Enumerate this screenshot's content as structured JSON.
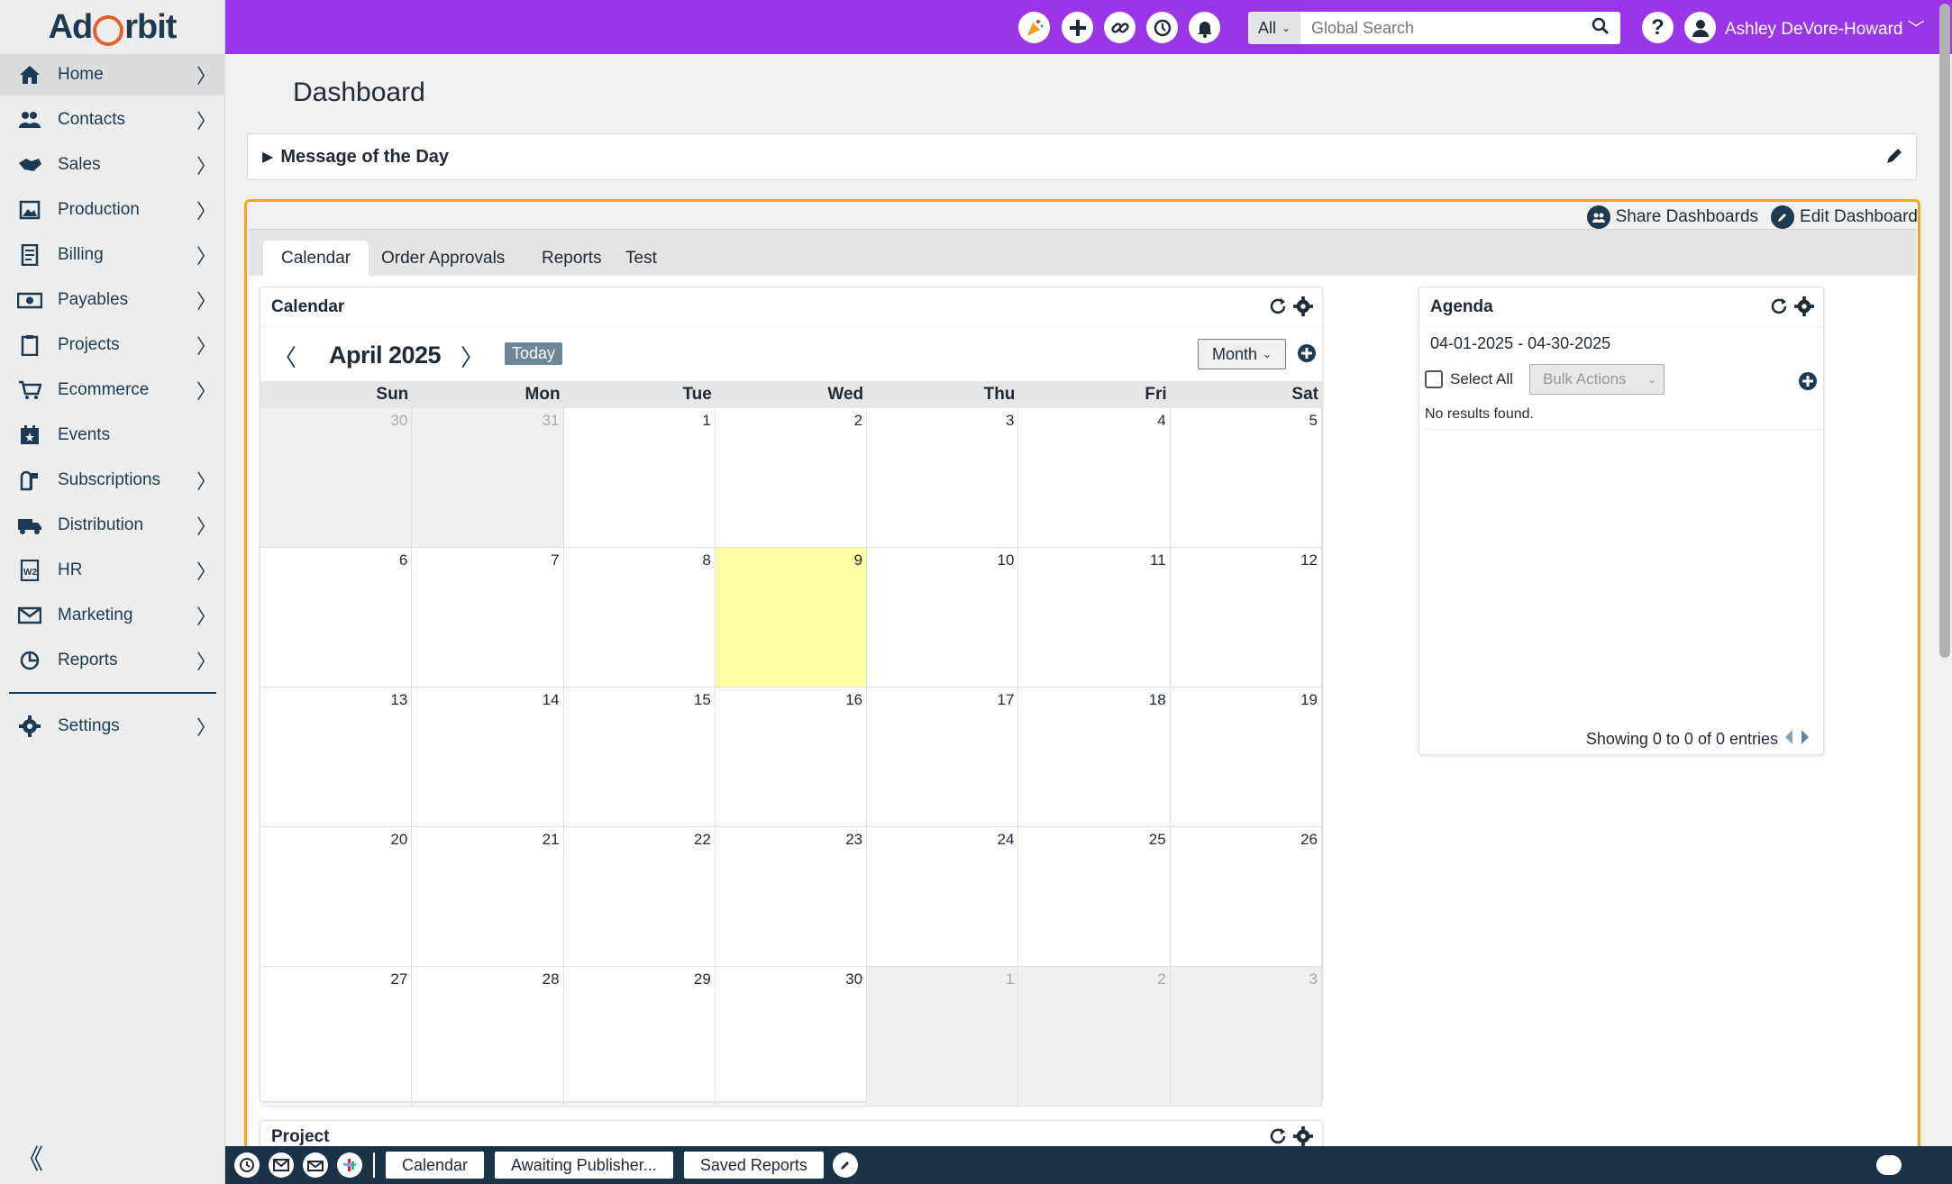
{
  "app": {
    "logo_text_left": "Ad",
    "logo_text_right": "rbit"
  },
  "sidebar": {
    "items": [
      {
        "label": "Home",
        "icon": "home-icon"
      },
      {
        "label": "Contacts",
        "icon": "contacts-icon"
      },
      {
        "label": "Sales",
        "icon": "handshake-icon"
      },
      {
        "label": "Production",
        "icon": "image-icon"
      },
      {
        "label": "Billing",
        "icon": "invoice-icon"
      },
      {
        "label": "Payables",
        "icon": "money-icon"
      },
      {
        "label": "Projects",
        "icon": "clipboard-icon"
      },
      {
        "label": "Ecommerce",
        "icon": "cart-icon"
      },
      {
        "label": "Events",
        "icon": "calendar-star-icon"
      },
      {
        "label": "Subscriptions",
        "icon": "mailbox-icon"
      },
      {
        "label": "Distribution",
        "icon": "truck-icon"
      },
      {
        "label": "HR",
        "icon": "w2-form-icon"
      },
      {
        "label": "Marketing",
        "icon": "envelope-icon"
      },
      {
        "label": "Reports",
        "icon": "pie-chart-icon"
      }
    ],
    "settings_label": "Settings"
  },
  "topbar": {
    "search_scope": "All",
    "search_placeholder": "Global Search",
    "user_name": "Ashley DeVore-Howard",
    "accent": "#9a36e8"
  },
  "page": {
    "title": "Dashboard"
  },
  "motd": {
    "title": "Message of the Day"
  },
  "dashboard": {
    "share_label": "Share Dashboards",
    "edit_label": "Edit Dashboard",
    "tabs": [
      "Calendar",
      "Order Approvals",
      "Reports",
      "Test"
    ],
    "frame_color": "#f6a623"
  },
  "calendar": {
    "title": "Calendar",
    "month_label": "April 2025",
    "today_label": "Today",
    "view": "Month",
    "weekdays": [
      "Sun",
      "Mon",
      "Tue",
      "Wed",
      "Thu",
      "Fri",
      "Sat"
    ],
    "days": [
      {
        "n": "30",
        "other": true
      },
      {
        "n": "31",
        "other": true
      },
      {
        "n": "1"
      },
      {
        "n": "2"
      },
      {
        "n": "3"
      },
      {
        "n": "4"
      },
      {
        "n": "5"
      },
      {
        "n": "6"
      },
      {
        "n": "7"
      },
      {
        "n": "8"
      },
      {
        "n": "9",
        "today": true
      },
      {
        "n": "10"
      },
      {
        "n": "11"
      },
      {
        "n": "12"
      },
      {
        "n": "13"
      },
      {
        "n": "14"
      },
      {
        "n": "15"
      },
      {
        "n": "16"
      },
      {
        "n": "17"
      },
      {
        "n": "18"
      },
      {
        "n": "19"
      },
      {
        "n": "20"
      },
      {
        "n": "21"
      },
      {
        "n": "22"
      },
      {
        "n": "23"
      },
      {
        "n": "24"
      },
      {
        "n": "25"
      },
      {
        "n": "26"
      },
      {
        "n": "27"
      },
      {
        "n": "28"
      },
      {
        "n": "29"
      },
      {
        "n": "30"
      },
      {
        "n": "1",
        "other": true
      },
      {
        "n": "2",
        "other": true
      },
      {
        "n": "3",
        "other": true
      }
    ]
  },
  "agenda": {
    "title": "Agenda",
    "range": "04-01-2025 - 04-30-2025",
    "select_all_label": "Select All",
    "bulk_actions_label": "Bulk Actions",
    "empty_text": "No results found.",
    "footer_text": "Showing 0 to 0 of 0 entries"
  },
  "project_widget": {
    "title": "Project"
  },
  "footer": {
    "tabs": [
      "Calendar",
      "Awaiting Publisher...",
      "Saved Reports"
    ]
  }
}
